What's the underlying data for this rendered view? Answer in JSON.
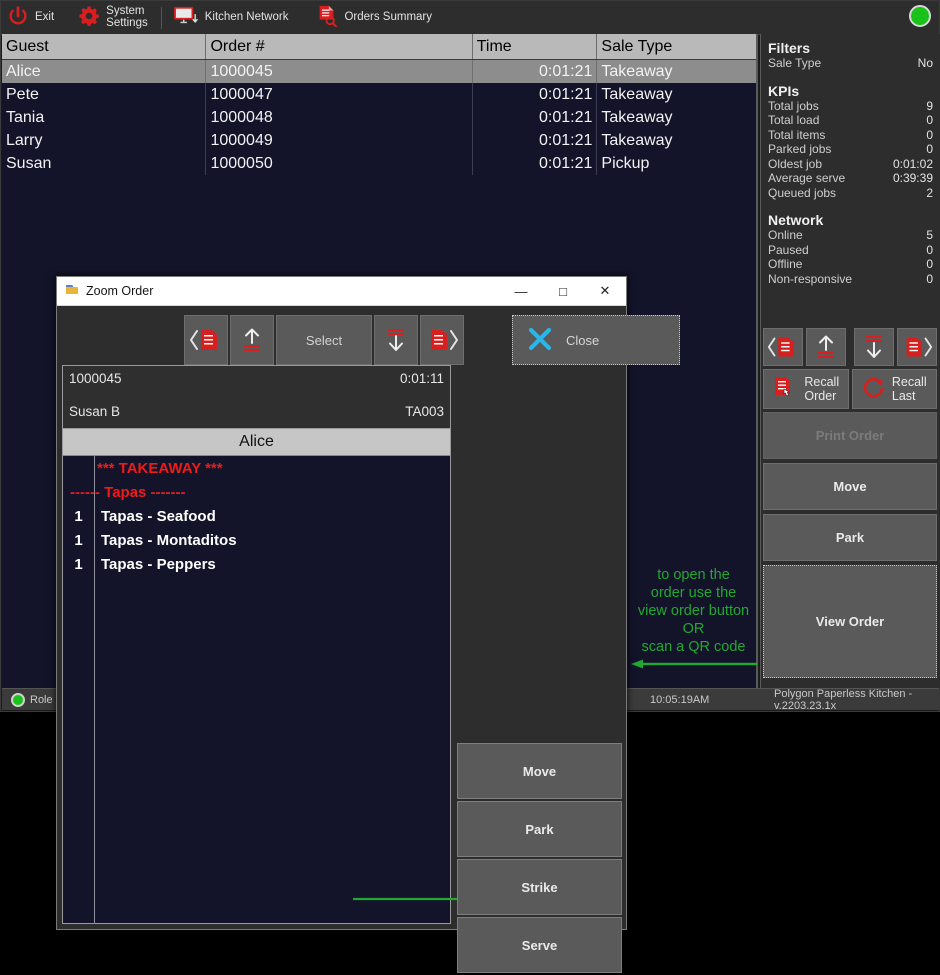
{
  "toolbar": {
    "exit_label": "Exit",
    "system_settings_line1": "System",
    "system_settings_line2": "Settings",
    "kitchen_network_label": "Kitchen Network",
    "orders_summary_label": "Orders Summary",
    "status_indicator": "online-green"
  },
  "orders_table": {
    "columns": [
      "Guest",
      "Order #",
      "Time",
      "Sale Type"
    ],
    "rows": [
      {
        "guest": "Alice",
        "order": "1000045",
        "time": "0:01:21",
        "sale_type": "Takeaway",
        "selected": true
      },
      {
        "guest": "Pete",
        "order": "1000047",
        "time": "0:01:21",
        "sale_type": "Takeaway",
        "selected": false
      },
      {
        "guest": "Tania",
        "order": "1000048",
        "time": "0:01:21",
        "sale_type": "Takeaway",
        "selected": false
      },
      {
        "guest": "Larry",
        "order": "1000049",
        "time": "0:01:21",
        "sale_type": "Takeaway",
        "selected": false
      },
      {
        "guest": "Susan",
        "order": "1000050",
        "time": "0:01:21",
        "sale_type": "Pickup",
        "selected": false
      }
    ]
  },
  "right_panel": {
    "filters_heading": "Filters",
    "filters": [
      {
        "label": "Sale Type",
        "value": "No"
      }
    ],
    "kpis_heading": "KPIs",
    "kpis": [
      {
        "label": "Total jobs",
        "value": "9"
      },
      {
        "label": "Total load",
        "value": "0"
      },
      {
        "label": "Total items",
        "value": "0"
      },
      {
        "label": "Parked jobs",
        "value": "0"
      },
      {
        "label": "Oldest job",
        "value": "0:01:02"
      },
      {
        "label": "Average serve",
        "value": "0:39:39"
      },
      {
        "label": "Queued jobs",
        "value": "2"
      }
    ],
    "network_heading": "Network",
    "network": [
      {
        "label": "Online",
        "value": "5"
      },
      {
        "label": "Paused",
        "value": "0"
      },
      {
        "label": "Offline",
        "value": "0"
      },
      {
        "label": "Non-responsive",
        "value": "0"
      }
    ]
  },
  "right_buttons": {
    "nav": [
      "prev-order-icon",
      "up-icon",
      "down-icon",
      "next-order-icon"
    ],
    "recall_order_l1": "Recall",
    "recall_order_l2": "Order",
    "recall_last_l1": "Recall",
    "recall_last_l2": "Last",
    "print_order": "Print Order",
    "move": "Move",
    "park": "Park",
    "view_order": "View Order"
  },
  "annotation": {
    "line1": "to open the",
    "line2": "order use the",
    "line3": "view order button",
    "line4": "OR",
    "line5": "scan a QR code",
    "color": "#22a832"
  },
  "status_bar": {
    "role_label": "Role",
    "clock": "10:05:19AM",
    "version": "Polygon Paperless Kitchen - v.2203.23.1x"
  },
  "dialog": {
    "title": "Zoom Order",
    "minimize": "—",
    "maximize": "□",
    "close_x": "✕",
    "toolbar": {
      "prev_icon": "prev-order-icon",
      "up_icon": "up-icon",
      "select_label": "Select",
      "down_icon": "down-icon",
      "next_icon": "next-order-icon",
      "close_label": "Close"
    },
    "order": {
      "number": "1000045",
      "elapsed": "0:01:11",
      "server": "Susan B",
      "table": "TA003",
      "guest": "Alice",
      "lines": [
        {
          "qty": "",
          "name": "*** TAKEAWAY ***",
          "style": "red"
        },
        {
          "qty": "",
          "name": "------ Tapas -------",
          "style": "red2"
        },
        {
          "qty": "1",
          "name": "Tapas - Seafood",
          "style": "normal"
        },
        {
          "qty": "1",
          "name": "Tapas - Montaditos",
          "style": "normal"
        },
        {
          "qty": "1",
          "name": "Tapas - Peppers",
          "style": "normal"
        }
      ]
    },
    "buttons": {
      "move": "Move",
      "park": "Park",
      "strike": "Strike",
      "serve": "Serve"
    }
  }
}
